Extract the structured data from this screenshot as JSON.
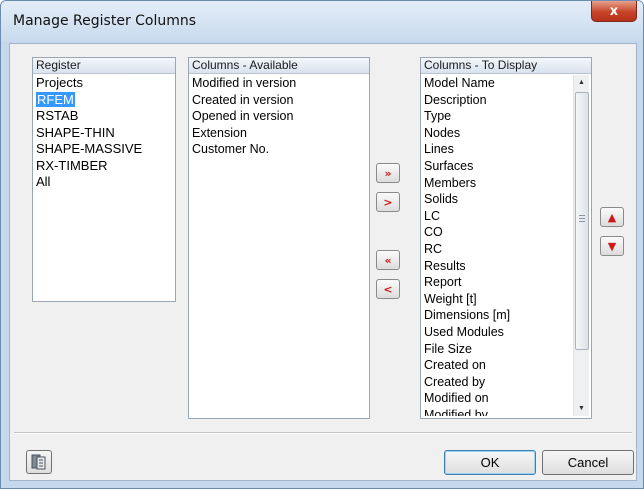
{
  "window": {
    "title": "Manage Register Columns",
    "close_label": "x"
  },
  "register": {
    "header": "Register",
    "items": [
      "Projects",
      "RFEM",
      "RSTAB",
      "SHAPE-THIN",
      "SHAPE-MASSIVE",
      "RX-TIMBER",
      "All"
    ],
    "selected": "RFEM"
  },
  "available": {
    "header": "Columns - Available",
    "items": [
      "Modified in version",
      "Created in version",
      "Opened in version",
      "Extension",
      "Customer No."
    ]
  },
  "display": {
    "header": "Columns - To Display",
    "items": [
      "Model Name",
      "Description",
      "Type",
      "Nodes",
      "Lines",
      "Surfaces",
      "Members",
      "Solids",
      "LC",
      "CO",
      "RC",
      "Results",
      "Report",
      "Weight [t]",
      "Dimensions [m]",
      "Used Modules",
      "File Size",
      "Created on",
      "Created by",
      "Modified on",
      "Modified by"
    ]
  },
  "transfer_buttons": {
    "add_all": "»",
    "add": ">",
    "remove_all": "«",
    "remove": "<"
  },
  "order_buttons": {
    "up": "▲",
    "down": "▼"
  },
  "buttons": {
    "ok": "OK",
    "cancel": "Cancel"
  },
  "colors": {
    "selection": "#3399ff",
    "arrow": "#d01818",
    "title_close": "#c6442a"
  }
}
